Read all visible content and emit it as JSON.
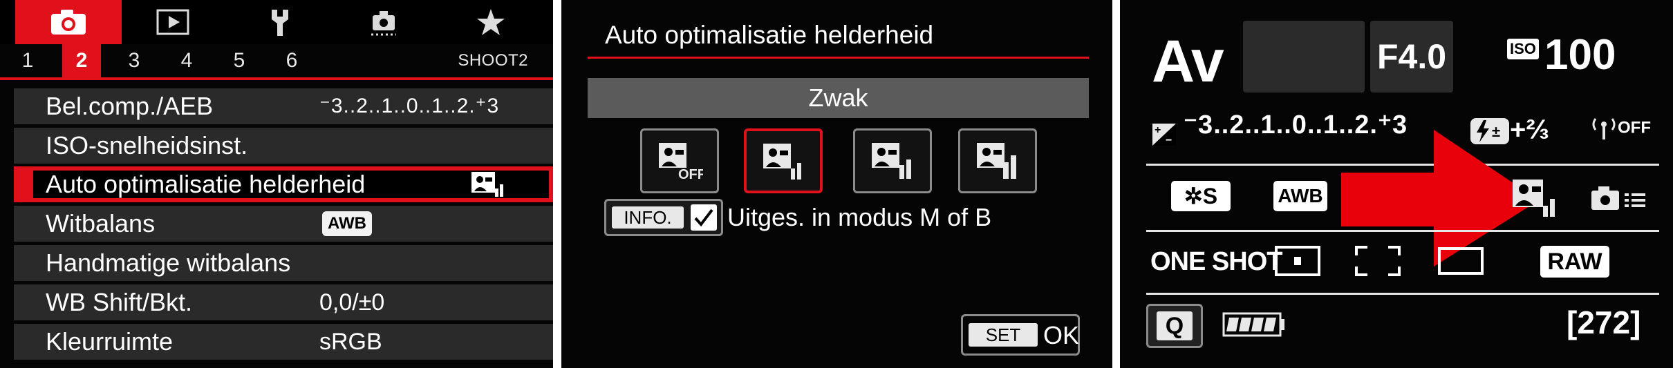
{
  "panel1": {
    "tabs": [
      {
        "icon": "camera-icon"
      },
      {
        "icon": "playback-icon"
      },
      {
        "icon": "wrench-icon"
      },
      {
        "icon": "custom-function-icon"
      },
      {
        "icon": "star-icon"
      }
    ],
    "subtabs": [
      "1",
      "2",
      "3",
      "4",
      "5",
      "6"
    ],
    "active_subtab": "2",
    "page_code": "SHOOT2",
    "menu": [
      {
        "label": "Bel.comp./AEB",
        "value": "⁻3..2..1..0..1..2.⁺3"
      },
      {
        "label": "ISO-snelheidsinst.",
        "value": ""
      },
      {
        "label": "Auto optimalisatie helderheid",
        "value": ""
      },
      {
        "label": "Witbalans",
        "value": "AWB"
      },
      {
        "label": "Handmatige witbalans",
        "value": ""
      },
      {
        "label": "WB Shift/Bkt.",
        "value": "0,0/±0"
      },
      {
        "label": "Kleurruimte",
        "value": "sRGB"
      }
    ],
    "accent": "#e0111a"
  },
  "panel2": {
    "title": "Auto optimalisatie helderheid",
    "selected_option": "Zwak",
    "options": [
      "alo-off-icon",
      "alo-low-icon",
      "alo-standard-icon",
      "alo-high-icon"
    ],
    "selected_index": 1,
    "info_label": "INFO.",
    "info_text": "Uitges. in modus M of B",
    "set_label": "SET",
    "ok_label": "OK"
  },
  "panel3": {
    "mode": "Av",
    "aperture": "F4.0",
    "iso_label": "ISO",
    "iso_value": "100",
    "exposure_scale": "⁻3..2..1..0..1..2.⁺3",
    "flash_comp": "+⅔",
    "wifi_status": "OFF",
    "picture_style": "S",
    "wb": "AWB",
    "af_mode": "ONE SHOT",
    "quality": "RAW",
    "quick_label": "Q",
    "shots_remaining": "[272]",
    "arrow_color": "#e8000b"
  }
}
